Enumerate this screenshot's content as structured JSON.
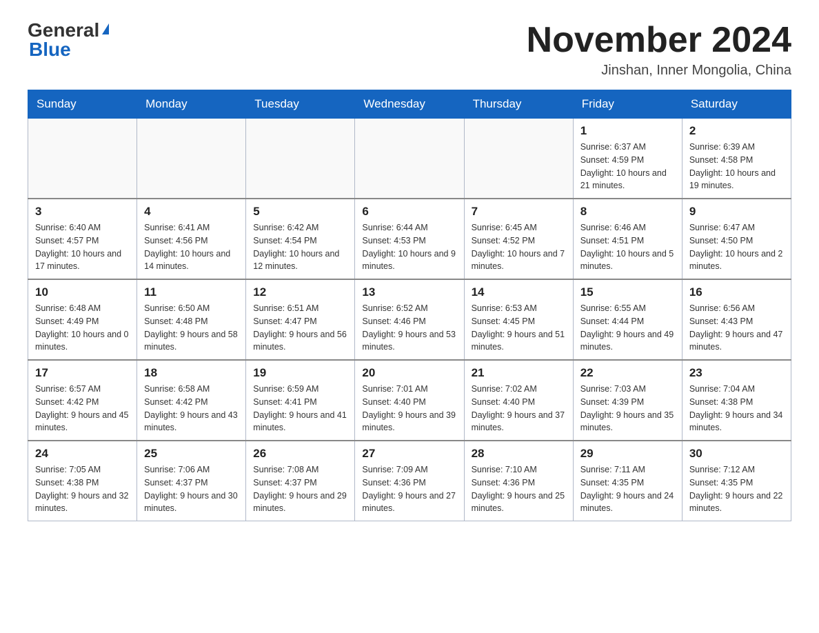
{
  "header": {
    "logo_general": "General",
    "logo_blue": "Blue",
    "title": "November 2024",
    "location": "Jinshan, Inner Mongolia, China"
  },
  "days_of_week": [
    "Sunday",
    "Monday",
    "Tuesday",
    "Wednesday",
    "Thursday",
    "Friday",
    "Saturday"
  ],
  "weeks": [
    [
      {
        "day": "",
        "info": ""
      },
      {
        "day": "",
        "info": ""
      },
      {
        "day": "",
        "info": ""
      },
      {
        "day": "",
        "info": ""
      },
      {
        "day": "",
        "info": ""
      },
      {
        "day": "1",
        "info": "Sunrise: 6:37 AM\nSunset: 4:59 PM\nDaylight: 10 hours and 21 minutes."
      },
      {
        "day": "2",
        "info": "Sunrise: 6:39 AM\nSunset: 4:58 PM\nDaylight: 10 hours and 19 minutes."
      }
    ],
    [
      {
        "day": "3",
        "info": "Sunrise: 6:40 AM\nSunset: 4:57 PM\nDaylight: 10 hours and 17 minutes."
      },
      {
        "day": "4",
        "info": "Sunrise: 6:41 AM\nSunset: 4:56 PM\nDaylight: 10 hours and 14 minutes."
      },
      {
        "day": "5",
        "info": "Sunrise: 6:42 AM\nSunset: 4:54 PM\nDaylight: 10 hours and 12 minutes."
      },
      {
        "day": "6",
        "info": "Sunrise: 6:44 AM\nSunset: 4:53 PM\nDaylight: 10 hours and 9 minutes."
      },
      {
        "day": "7",
        "info": "Sunrise: 6:45 AM\nSunset: 4:52 PM\nDaylight: 10 hours and 7 minutes."
      },
      {
        "day": "8",
        "info": "Sunrise: 6:46 AM\nSunset: 4:51 PM\nDaylight: 10 hours and 5 minutes."
      },
      {
        "day": "9",
        "info": "Sunrise: 6:47 AM\nSunset: 4:50 PM\nDaylight: 10 hours and 2 minutes."
      }
    ],
    [
      {
        "day": "10",
        "info": "Sunrise: 6:48 AM\nSunset: 4:49 PM\nDaylight: 10 hours and 0 minutes."
      },
      {
        "day": "11",
        "info": "Sunrise: 6:50 AM\nSunset: 4:48 PM\nDaylight: 9 hours and 58 minutes."
      },
      {
        "day": "12",
        "info": "Sunrise: 6:51 AM\nSunset: 4:47 PM\nDaylight: 9 hours and 56 minutes."
      },
      {
        "day": "13",
        "info": "Sunrise: 6:52 AM\nSunset: 4:46 PM\nDaylight: 9 hours and 53 minutes."
      },
      {
        "day": "14",
        "info": "Sunrise: 6:53 AM\nSunset: 4:45 PM\nDaylight: 9 hours and 51 minutes."
      },
      {
        "day": "15",
        "info": "Sunrise: 6:55 AM\nSunset: 4:44 PM\nDaylight: 9 hours and 49 minutes."
      },
      {
        "day": "16",
        "info": "Sunrise: 6:56 AM\nSunset: 4:43 PM\nDaylight: 9 hours and 47 minutes."
      }
    ],
    [
      {
        "day": "17",
        "info": "Sunrise: 6:57 AM\nSunset: 4:42 PM\nDaylight: 9 hours and 45 minutes."
      },
      {
        "day": "18",
        "info": "Sunrise: 6:58 AM\nSunset: 4:42 PM\nDaylight: 9 hours and 43 minutes."
      },
      {
        "day": "19",
        "info": "Sunrise: 6:59 AM\nSunset: 4:41 PM\nDaylight: 9 hours and 41 minutes."
      },
      {
        "day": "20",
        "info": "Sunrise: 7:01 AM\nSunset: 4:40 PM\nDaylight: 9 hours and 39 minutes."
      },
      {
        "day": "21",
        "info": "Sunrise: 7:02 AM\nSunset: 4:40 PM\nDaylight: 9 hours and 37 minutes."
      },
      {
        "day": "22",
        "info": "Sunrise: 7:03 AM\nSunset: 4:39 PM\nDaylight: 9 hours and 35 minutes."
      },
      {
        "day": "23",
        "info": "Sunrise: 7:04 AM\nSunset: 4:38 PM\nDaylight: 9 hours and 34 minutes."
      }
    ],
    [
      {
        "day": "24",
        "info": "Sunrise: 7:05 AM\nSunset: 4:38 PM\nDaylight: 9 hours and 32 minutes."
      },
      {
        "day": "25",
        "info": "Sunrise: 7:06 AM\nSunset: 4:37 PM\nDaylight: 9 hours and 30 minutes."
      },
      {
        "day": "26",
        "info": "Sunrise: 7:08 AM\nSunset: 4:37 PM\nDaylight: 9 hours and 29 minutes."
      },
      {
        "day": "27",
        "info": "Sunrise: 7:09 AM\nSunset: 4:36 PM\nDaylight: 9 hours and 27 minutes."
      },
      {
        "day": "28",
        "info": "Sunrise: 7:10 AM\nSunset: 4:36 PM\nDaylight: 9 hours and 25 minutes."
      },
      {
        "day": "29",
        "info": "Sunrise: 7:11 AM\nSunset: 4:35 PM\nDaylight: 9 hours and 24 minutes."
      },
      {
        "day": "30",
        "info": "Sunrise: 7:12 AM\nSunset: 4:35 PM\nDaylight: 9 hours and 22 minutes."
      }
    ]
  ]
}
